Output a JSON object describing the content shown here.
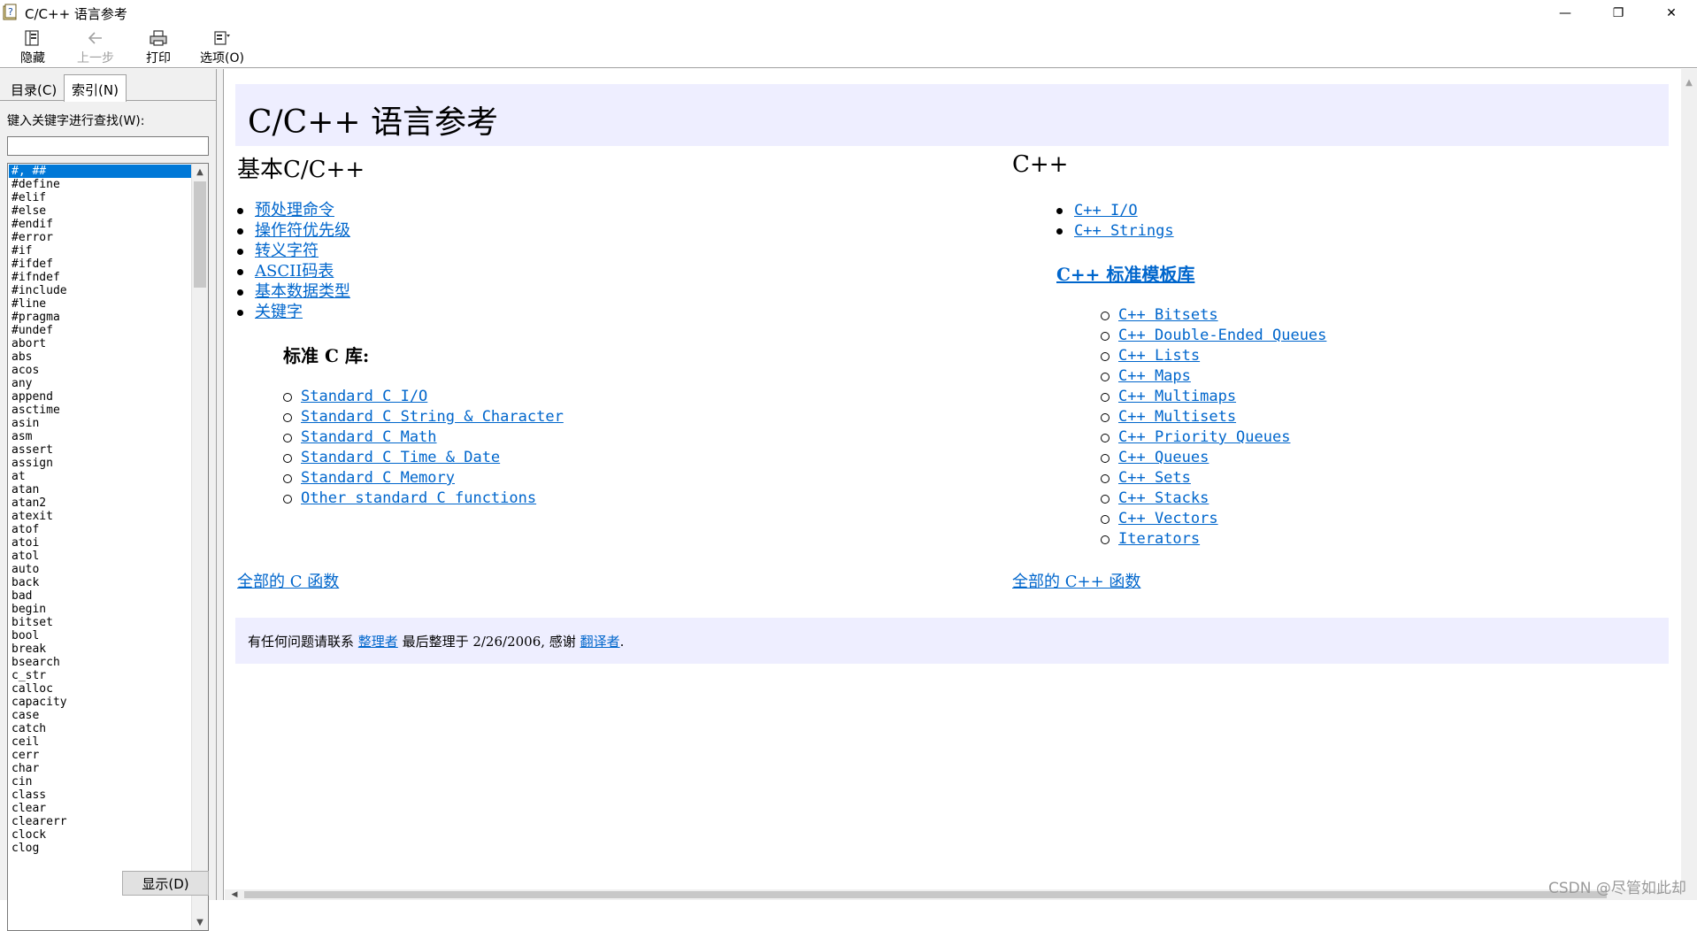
{
  "window": {
    "title": "C/C++ 语言参考",
    "minimize": "—",
    "maximize": "❐",
    "close": "✕"
  },
  "toolbar": {
    "hide_label": "隐藏",
    "back_label": "上一步",
    "print_label": "打印",
    "options_label": "选项(O)"
  },
  "nav": {
    "tabs": [
      "目录(C)",
      "索引(N)"
    ],
    "active_tab": "索引(N)",
    "search_label": "键入关键字进行查找(W):",
    "search_value": "",
    "keywords": [
      "#, ##",
      "#define",
      "#elif",
      "#else",
      "#endif",
      "#error",
      "#if",
      "#ifdef",
      "#ifndef",
      "#include",
      "#line",
      "#pragma",
      "#undef",
      "abort",
      "abs",
      "acos",
      "any",
      "append",
      "asctime",
      "asin",
      "asm",
      "assert",
      "assign",
      "at",
      "atan",
      "atan2",
      "atexit",
      "atof",
      "atoi",
      "atol",
      "auto",
      "back",
      "bad",
      "begin",
      "bitset",
      "bool",
      "break",
      "bsearch",
      "c_str",
      "calloc",
      "capacity",
      "case",
      "catch",
      "ceil",
      "cerr",
      "char",
      "cin",
      "class",
      "clear",
      "clearerr",
      "clock",
      "clog"
    ],
    "selected_keyword": "#, ##",
    "display_button": "显示(D)"
  },
  "content": {
    "page_title": "C/C++ 语言参考",
    "left_heading": "基本C/C++",
    "basic_links": [
      "预处理命令",
      "操作符优先级",
      "转义字符",
      "ASCII码表",
      "基本数据类型",
      "关键字"
    ],
    "stdc_heading": "标准 C 库:",
    "stdc_links": [
      "Standard C I/O",
      "Standard C String & Character",
      "Standard C Math",
      "Standard C Time & Date",
      "Standard C Memory",
      "Other standard C functions"
    ],
    "all_c_link": "全部的 C 函数",
    "right_heading": "C++",
    "cpp_links": [
      "C++ I/O",
      "C++ Strings"
    ],
    "stl_heading": "C++ 标准模板库",
    "stl_links": [
      "C++ Bitsets",
      "C++ Double-Ended Queues",
      "C++ Lists",
      "C++ Maps",
      "C++ Multimaps",
      "C++ Multisets",
      "C++ Priority Queues",
      "C++ Queues",
      "C++ Sets",
      "C++ Stacks",
      "C++ Vectors",
      "Iterators"
    ],
    "all_cpp_link": "全部的 C++ 函数",
    "footer": {
      "text_1": "有任何问题请联系 ",
      "maintainer_link": "整理者",
      "text_2": " 最后整理于 2/26/2006, 感谢 ",
      "translator_link": "翻译者",
      "text_3": "."
    }
  },
  "watermark": "CSDN @尽管如此却",
  "colors": {
    "link": "#0066cc",
    "band_background": "#eeeeff",
    "selection": "#0078d7"
  },
  "icons": {
    "app": "help-book-icon",
    "hide": "hide-pane-icon",
    "back": "back-arrow-icon",
    "print": "printer-icon",
    "options": "options-icon"
  }
}
